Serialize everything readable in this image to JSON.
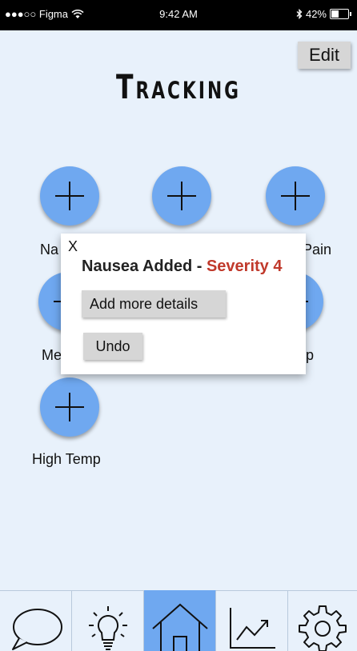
{
  "status_bar": {
    "carrier": "●●●○○ Figma",
    "time": "9:42 AM",
    "battery": "42%"
  },
  "header": {
    "edit_label": "Edit",
    "title": "Tracking"
  },
  "trackers": [
    {
      "label": "Na",
      "icon": "plus-icon"
    },
    {
      "label": "",
      "icon": "plus-icon"
    },
    {
      "label": "Pain",
      "icon": "plus-icon"
    },
    {
      "label": "Me",
      "icon": "plus-icon"
    },
    {
      "label": "p",
      "icon": "plus-icon"
    },
    {
      "label": "High Temp",
      "icon": "plus-icon"
    }
  ],
  "modal": {
    "close_label": "X",
    "message_prefix": "Nausea Added - ",
    "severity": "Severity 4",
    "details_label": "Add more details",
    "undo_label": "Undo"
  },
  "tabs": [
    {
      "name": "chat",
      "icon": "speech-bubble-icon",
      "active": false
    },
    {
      "name": "tips",
      "icon": "lightbulb-icon",
      "active": false
    },
    {
      "name": "home",
      "icon": "home-icon",
      "active": true
    },
    {
      "name": "trends",
      "icon": "trend-chart-icon",
      "active": false
    },
    {
      "name": "settings",
      "icon": "gear-icon",
      "active": false
    }
  ],
  "colors": {
    "accent": "#6fa8f0",
    "background": "#e8f1fb",
    "severity": "#c0392b"
  }
}
